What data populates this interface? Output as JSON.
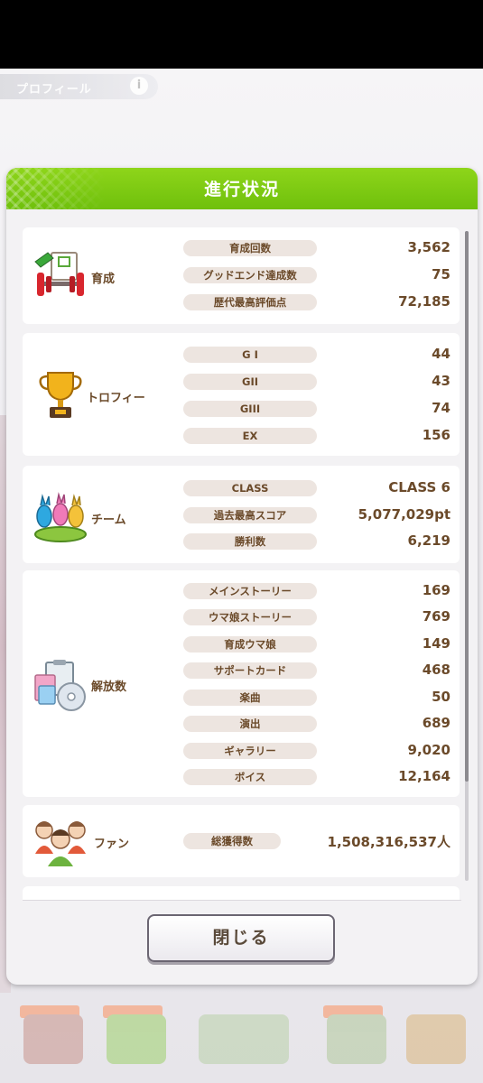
{
  "profile_tab": {
    "label": "プロフィール",
    "help": "i"
  },
  "dialog": {
    "title": "進行状況",
    "close_label": "閉じる",
    "sections": [
      {
        "category": "育成",
        "icon": "training-icon",
        "rows": [
          {
            "label": "育成回数",
            "value": "3,562"
          },
          {
            "label": "グッドエンド達成数",
            "value": "75"
          },
          {
            "label": "歴代最高評価点",
            "value": "72,185"
          }
        ]
      },
      {
        "category": "トロフィー",
        "icon": "trophy-icon",
        "rows": [
          {
            "label": "G I",
            "value": "44"
          },
          {
            "label": "GII",
            "value": "43"
          },
          {
            "label": "GIII",
            "value": "74"
          },
          {
            "label": "EX",
            "value": "156"
          }
        ]
      },
      {
        "category": "チーム",
        "icon": "team-icon",
        "rows": [
          {
            "label": "CLASS",
            "value": "CLASS 6"
          },
          {
            "label": "過去最高スコア",
            "value": "5,077,029pt"
          },
          {
            "label": "勝利数",
            "value": "6,219"
          }
        ]
      },
      {
        "category": "解放数",
        "icon": "unlock-icon",
        "rows": [
          {
            "label": "メインストーリー",
            "value": "169"
          },
          {
            "label": "ウマ娘ストーリー",
            "value": "769"
          },
          {
            "label": "育成ウマ娘",
            "value": "149"
          },
          {
            "label": "サポートカード",
            "value": "468"
          },
          {
            "label": "楽曲",
            "value": "50"
          },
          {
            "label": "演出",
            "value": "689"
          },
          {
            "label": "ギャラリー",
            "value": "9,020"
          },
          {
            "label": "ボイス",
            "value": "12,164"
          }
        ]
      },
      {
        "category": "ファン",
        "icon": "fans-icon",
        "rows": [
          {
            "label": "総獲得数",
            "value": "1,508,316,537人"
          }
        ]
      }
    ]
  },
  "colors": {
    "header_green": "#7cc912",
    "text_brown": "#6b4a2a",
    "pill_bg": "#ede5e0"
  }
}
